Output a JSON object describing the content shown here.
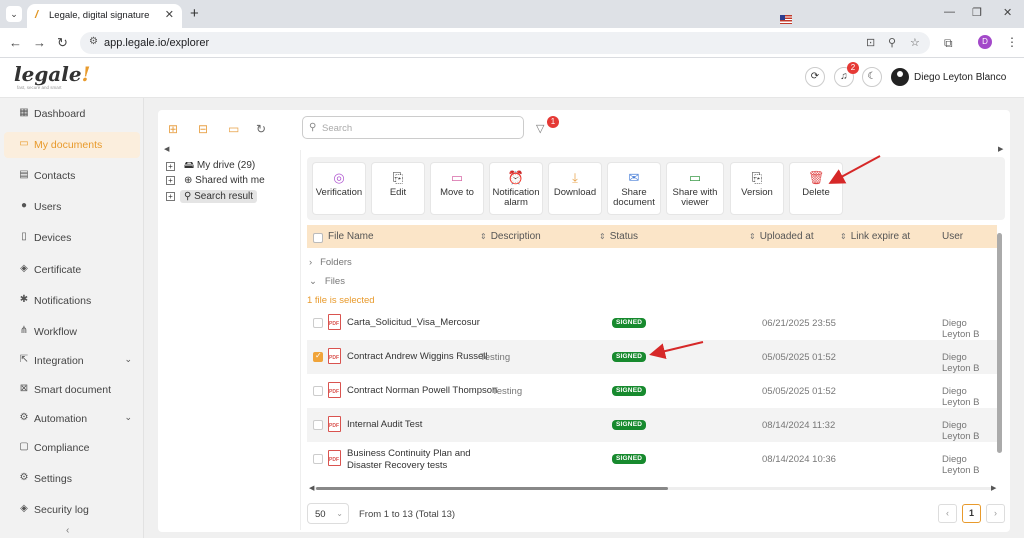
{
  "browser": {
    "tab_title": "Legale, digital signature",
    "url": "app.legale.io/explorer",
    "profile_initial": "D"
  },
  "header": {
    "logo_text": "legale",
    "logo_tagline": "fast, secure and smart",
    "notification_count": "2",
    "user_name": "Diego Leyton Blanco"
  },
  "sidebar": {
    "items": [
      {
        "label": "Dashboard",
        "icon": "dashboard-icon"
      },
      {
        "label": "My documents",
        "icon": "folder-icon",
        "active": true
      },
      {
        "label": "Contacts",
        "icon": "contacts-icon"
      },
      {
        "label": "Users",
        "icon": "user-icon"
      },
      {
        "label": "Devices",
        "icon": "device-icon"
      },
      {
        "label": "Certificate",
        "icon": "shield-icon"
      },
      {
        "label": "Notifications",
        "icon": "notification-icon"
      },
      {
        "label": "Workflow",
        "icon": "workflow-icon"
      },
      {
        "label": "Integration",
        "icon": "integration-icon",
        "expandable": true
      },
      {
        "label": "Smart document",
        "icon": "smart-document-icon"
      },
      {
        "label": "Automation",
        "icon": "automation-icon",
        "expandable": true
      },
      {
        "label": "Compliance",
        "icon": "compliance-icon"
      },
      {
        "label": "Settings",
        "icon": "gear-icon"
      },
      {
        "label": "Security log",
        "icon": "security-icon"
      }
    ]
  },
  "search": {
    "placeholder": "Search"
  },
  "filter_count": "1",
  "tree": {
    "my_drive": "My drive (29)",
    "shared": "Shared with me",
    "search_result": "Search result"
  },
  "toolbar": [
    {
      "label": "Verification",
      "icon": "verification-icon"
    },
    {
      "label": "Edit",
      "icon": "edit-icon"
    },
    {
      "label": "Move to",
      "icon": "move-to-icon"
    },
    {
      "label": "Notification alarm",
      "icon": "alarm-icon"
    },
    {
      "label": "Download",
      "icon": "download-icon"
    },
    {
      "label": "Share document",
      "icon": "share-document-icon"
    },
    {
      "label": "Share with viewer",
      "icon": "share-viewer-icon"
    },
    {
      "label": "Version",
      "icon": "version-icon"
    },
    {
      "label": "Delete",
      "icon": "delete-icon"
    }
  ],
  "table": {
    "columns": [
      "File Name",
      "Description",
      "Status",
      "Uploaded at",
      "Link expire at",
      "User"
    ],
    "groups": {
      "folders": "Folders",
      "files": "Files"
    },
    "selection_info": "1 file is selected",
    "rows": [
      {
        "name": "Carta_Solicitud_Visa_Mercosur",
        "description": "",
        "status": "SIGNED",
        "uploaded": "06/21/2025 23:55",
        "user": "Diego Leyton B",
        "checked": false
      },
      {
        "name": "Contract Andrew Wiggins Russell",
        "description": "Testing",
        "status": "SIGNED",
        "uploaded": "05/05/2025 01:52",
        "user": "Diego Leyton B",
        "checked": true
      },
      {
        "name": "Contract Norman Powell Thompson",
        "description": "Testing",
        "status": "SIGNED",
        "uploaded": "05/05/2025 01:52",
        "user": "Diego Leyton B",
        "checked": false
      },
      {
        "name": "Internal Audit Test",
        "description": "",
        "status": "SIGNED",
        "uploaded": "08/14/2024 11:32",
        "user": "Diego Leyton B",
        "checked": false
      },
      {
        "name": "Business Continuity Plan and Disaster Recovery tests",
        "description": "",
        "status": "SIGNED",
        "uploaded": "08/14/2024 10:36",
        "user": "Diego Leyton B",
        "checked": false
      }
    ]
  },
  "footer": {
    "page_size": "50",
    "range_text": "From 1 to 13 (Total 13)",
    "current_page": "1"
  },
  "colors": {
    "accent": "#e89a2c",
    "signed_badge": "#178a2e",
    "header_row": "#fbe5c8",
    "annotation_arrow": "#d62828"
  }
}
